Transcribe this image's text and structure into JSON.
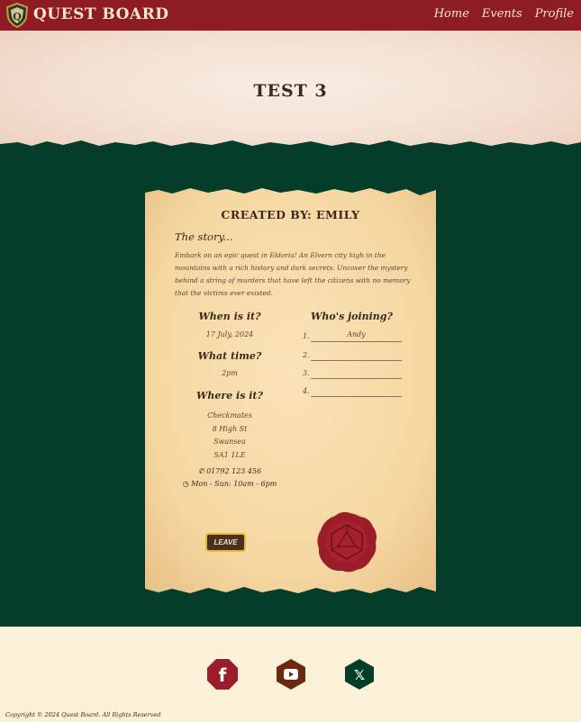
{
  "nav": {
    "brand": "Quest Board",
    "links": [
      "Home",
      "Events",
      "Profile"
    ]
  },
  "hero": {
    "title": "TEST 3"
  },
  "event": {
    "created_by": "Created by: Emily",
    "story_heading": "The story...",
    "story": "Embark on an epic quest in Eldoria! An Elvern city high in the mountains with a rich history and dark secrets. Uncover the mystery behind a string of murders that have left the citizens with no memory that the victims ever existed.",
    "when_heading": "When is it?",
    "date": "17 July, 2024",
    "time_heading": "What time?",
    "time": "2pm",
    "where_heading": "Where is it?",
    "address": [
      "Checkmates",
      "8 High St",
      "Swansea",
      "SA1 1LE"
    ],
    "phone": "01792 123 456",
    "hours": "Mon - Sun: 10am - 6pm",
    "joining_heading": "Who's joining?",
    "joining": [
      {
        "num": "1.",
        "name": "Andy"
      },
      {
        "num": "2.",
        "name": ""
      },
      {
        "num": "3.",
        "name": ""
      },
      {
        "num": "4.",
        "name": ""
      }
    ],
    "leave_label": "LEAVE"
  },
  "footer": {
    "copyright": "Copyright © 2024 Quest Board. All Rights Reserved",
    "socials": [
      "facebook-icon",
      "youtube-icon",
      "x-icon"
    ]
  },
  "colors": {
    "nav": "#8e1c24",
    "green": "#043d2a",
    "parchment": "#f5dcaa",
    "seal": "#9b1c2a",
    "leave_border": "#e8b832"
  }
}
